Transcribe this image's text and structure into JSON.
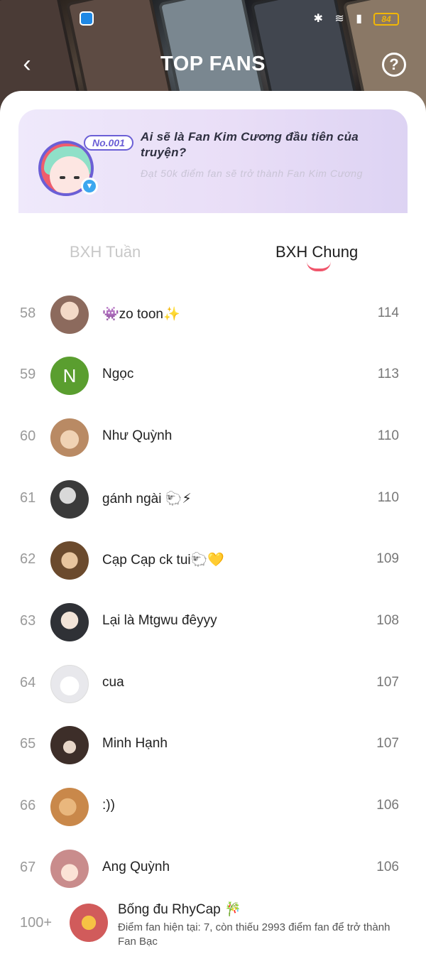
{
  "status": {
    "battery": "84"
  },
  "header": {
    "title": "TOP FANS",
    "back_icon": "‹",
    "help_icon": "?"
  },
  "banner": {
    "badge": "No.001",
    "title": "Ai sẽ là Fan Kim Cương đầu tiên của truyện?",
    "subtitle": "Đạt 50k điểm fan sẽ trở thành Fan Kim Cương"
  },
  "tabs": [
    {
      "label": "BXH Tuần",
      "active": false
    },
    {
      "label": "BXH Chung",
      "active": true
    }
  ],
  "ranking": [
    {
      "rank": "58",
      "name": "👾zo toon✨",
      "score": "114",
      "avatar_color": "#8c6a5d"
    },
    {
      "rank": "59",
      "name": "Ngọc",
      "score": "113",
      "avatar_letter": "N",
      "avatar_color": "#5a9e2f"
    },
    {
      "rank": "60",
      "name": "Như Quỳnh",
      "score": "110",
      "avatar_color": "#b98a64"
    },
    {
      "rank": "61",
      "name": "gánh ngài 🐑⚡",
      "score": "110",
      "avatar_color": "#3a3a3a"
    },
    {
      "rank": "62",
      "name": "Cạp Cạp ck tui🐑💛",
      "score": "109",
      "avatar_color": "#6b4a2d"
    },
    {
      "rank": "63",
      "name": "Lại là Mtgwu đêyyy",
      "score": "108",
      "avatar_color": "#2f3136"
    },
    {
      "rank": "64",
      "name": "cua",
      "score": "107",
      "avatar_color": "#e8e8ec"
    },
    {
      "rank": "65",
      "name": "Minh Hạnh",
      "score": "107",
      "avatar_color": "#3d2e29"
    },
    {
      "rank": "66",
      "name": ":))",
      "score": "106",
      "avatar_color": "#c9884a"
    },
    {
      "rank": "67",
      "name": "Ang Quỳnh",
      "score": "106",
      "avatar_color": "#c98c8c"
    }
  ],
  "my_rank": {
    "rank": "100+",
    "name": "Bống đu RhyCap 🎋",
    "description": "Điểm fan hiện tại: 7, còn thiếu 2993 điểm fan để trở thành Fan Bạc",
    "avatar_color": "#d15b5b"
  }
}
